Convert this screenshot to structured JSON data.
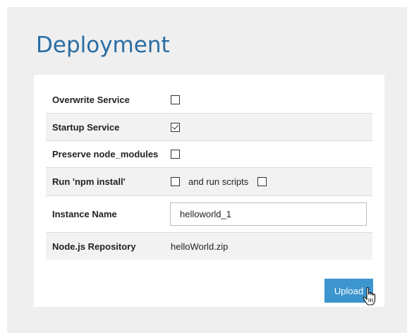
{
  "page": {
    "title": "Deployment"
  },
  "form": {
    "overwrite_service": {
      "label": "Overwrite Service",
      "checked": false
    },
    "startup_service": {
      "label": "Startup Service",
      "checked": true
    },
    "preserve_node_modules": {
      "label": "Preserve node_modules",
      "checked": false
    },
    "run_npm_install": {
      "label": "Run 'npm install'",
      "checked": false,
      "run_scripts_label": "and run scripts",
      "run_scripts_checked": false
    },
    "instance_name": {
      "label": "Instance Name",
      "value": "helloworld_1"
    },
    "nodejs_repository": {
      "label": "Node.js Repository",
      "value": "helloWorld.zip"
    }
  },
  "actions": {
    "upload_label": "Upload"
  },
  "icons": {
    "cursor": "hand-pointer-icon"
  },
  "colors": {
    "title": "#2a6da3",
    "button": "#3c95cf",
    "background": "#efefef",
    "row_alt": "#f2f2f2"
  }
}
